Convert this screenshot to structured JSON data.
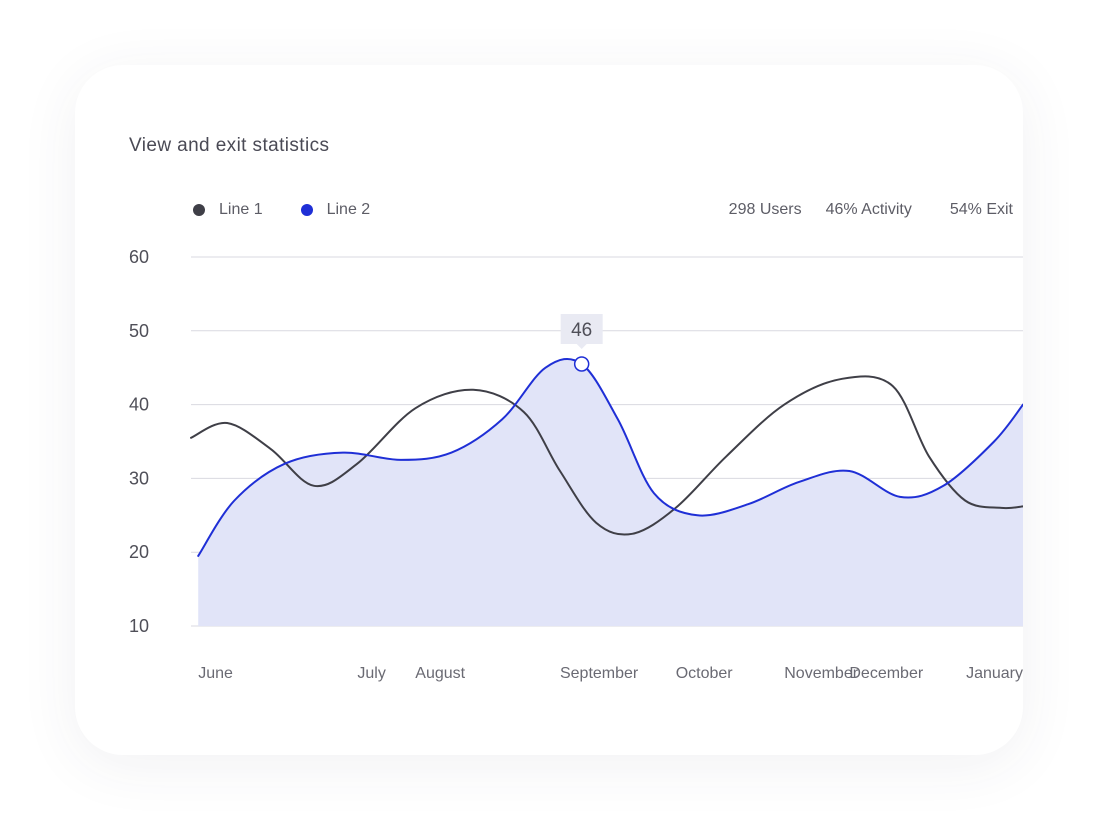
{
  "card": {
    "title": "View and exit statistics"
  },
  "stats": [
    {
      "label": "298 Users"
    },
    {
      "label": "46% Activity"
    },
    {
      "label": "54% Exit"
    }
  ],
  "colors": {
    "line1": "#3f3f47",
    "line2": "#1f2fd6",
    "area2": "#e1e4f8",
    "grid": "#d9d9e0"
  },
  "chart_data": {
    "type": "line",
    "x": [
      "June",
      "July",
      "August",
      "September",
      "October",
      "November",
      "December",
      "January"
    ],
    "x_positions": [
      0,
      2.2,
      3,
      5,
      6.6,
      8.1,
      9,
      10.6
    ],
    "series": [
      {
        "name": "Line 1",
        "color": "#3f3f47",
        "points": [
          [
            -0.1,
            35.5
          ],
          [
            0.4,
            37.5
          ],
          [
            1.0,
            34
          ],
          [
            1.6,
            29
          ],
          [
            2.2,
            32
          ],
          [
            3.0,
            39.5
          ],
          [
            3.8,
            42
          ],
          [
            4.5,
            39
          ],
          [
            5.0,
            31
          ],
          [
            5.5,
            24
          ],
          [
            6.0,
            22.5
          ],
          [
            6.6,
            26
          ],
          [
            7.3,
            33
          ],
          [
            8.1,
            40
          ],
          [
            8.9,
            43.5
          ],
          [
            9.6,
            42.5
          ],
          [
            10.1,
            33
          ],
          [
            10.6,
            27
          ],
          [
            11.1,
            26
          ],
          [
            11.4,
            26.2
          ]
        ],
        "filled": false
      },
      {
        "name": "Line 2",
        "color": "#1f2fd6",
        "points": [
          [
            0,
            19.5
          ],
          [
            0.5,
            27
          ],
          [
            1.2,
            32
          ],
          [
            2.0,
            33.5
          ],
          [
            2.8,
            32.5
          ],
          [
            3.5,
            33.5
          ],
          [
            4.2,
            38
          ],
          [
            4.8,
            45
          ],
          [
            5.3,
            45.5
          ],
          [
            5.8,
            38
          ],
          [
            6.3,
            28
          ],
          [
            6.9,
            25
          ],
          [
            7.6,
            26.5
          ],
          [
            8.3,
            29.5
          ],
          [
            9.0,
            31
          ],
          [
            9.7,
            27.5
          ],
          [
            10.3,
            29
          ],
          [
            11.0,
            35
          ],
          [
            11.4,
            40
          ]
        ],
        "filled": true
      }
    ],
    "annotation": {
      "series": "Line 2",
      "x": 5.3,
      "y": 45.5,
      "label": "46"
    },
    "yticks": [
      10,
      20,
      30,
      40,
      50,
      60
    ],
    "ylim": [
      10,
      60
    ],
    "xlim": [
      -0.1,
      11.4
    ],
    "grid": true,
    "legend": "top-left"
  }
}
